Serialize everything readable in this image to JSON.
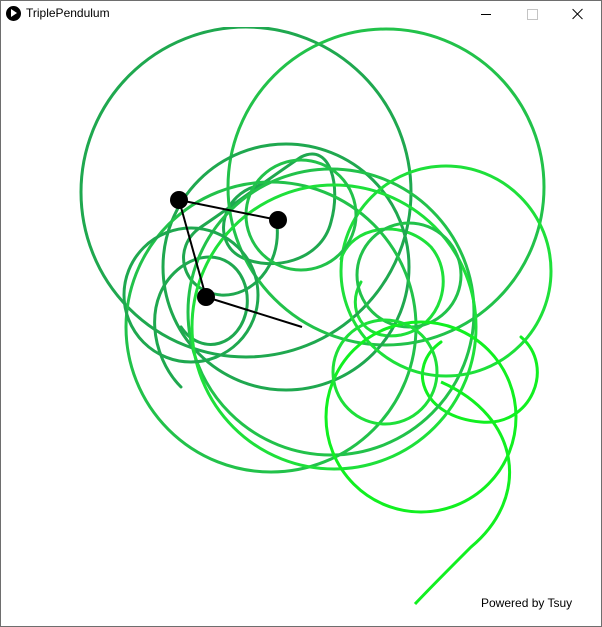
{
  "window": {
    "title": "TriplePendulum"
  },
  "controls": {
    "minimize_icon": "minimize-icon",
    "maximize_icon": "maximize-icon",
    "close_icon": "close-icon"
  },
  "canvas": {
    "footer_text": "Powered by Tsuy",
    "background": "#ffffff",
    "rod_color": "#000000",
    "bob_color": "#000000",
    "trail_colors": [
      "#1fa84f",
      "#22c24a",
      "#1ee03a",
      "#11f020"
    ]
  }
}
